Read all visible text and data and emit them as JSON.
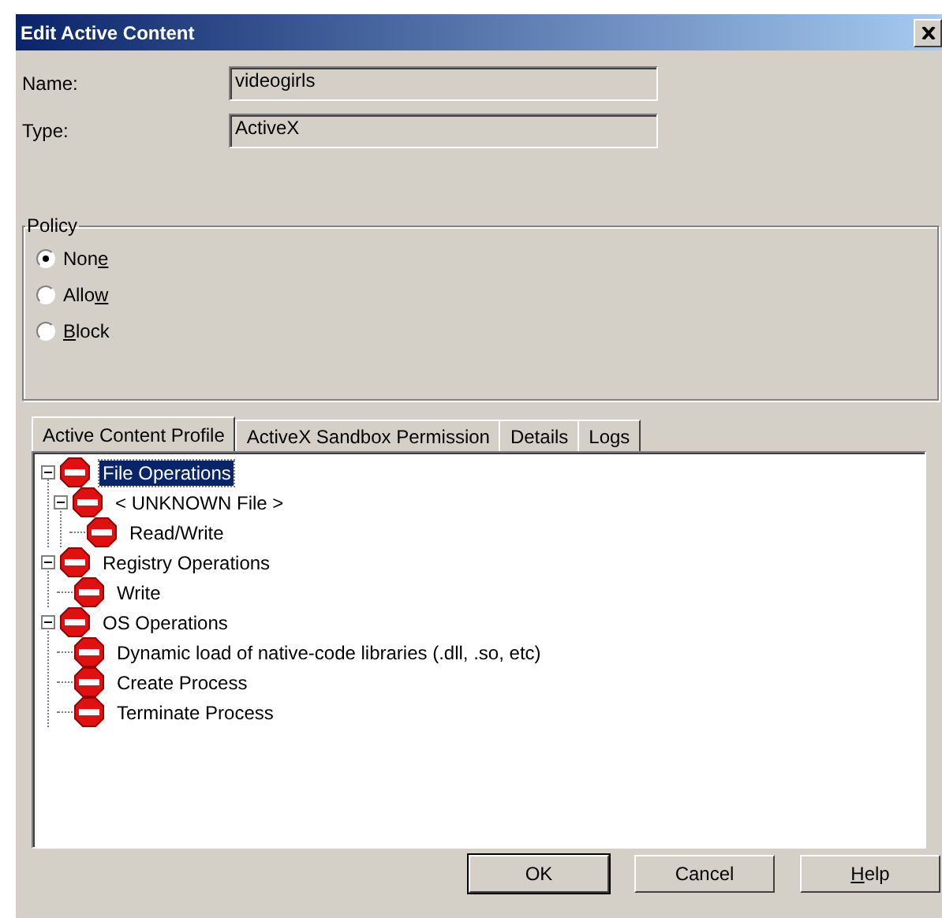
{
  "window": {
    "title": "Edit Active Content"
  },
  "fields": [
    {
      "label": "Name:",
      "value": "videogirls"
    },
    {
      "label": "Type:",
      "value": "ActiveX"
    }
  ],
  "policy": {
    "title": "Policy",
    "options": [
      {
        "before": "Non",
        "key": "e",
        "selected": true
      },
      {
        "before": "Allo",
        "key": "w",
        "selected": false
      },
      {
        "key": "B",
        "after": "lock",
        "selected": false
      }
    ]
  },
  "tabs": [
    {
      "label": "Active Content Profile",
      "selected": true
    },
    {
      "label": "ActiveX  Sandbox Permission",
      "selected": false
    },
    {
      "label": "Details",
      "selected": false
    },
    {
      "label": "Logs",
      "selected": false
    }
  ],
  "tree": [
    {
      "label": "File Operations",
      "selected": true,
      "expanded": true,
      "children": [
        {
          "label": "< UNKNOWN File >",
          "selected": false,
          "expanded": true,
          "children": [
            {
              "label": "Read/Write",
              "selected": false
            }
          ]
        }
      ]
    },
    {
      "label": "Registry Operations",
      "selected": false,
      "expanded": true,
      "children": [
        {
          "label": "Write",
          "selected": false
        }
      ]
    },
    {
      "label": "OS Operations",
      "selected": false,
      "expanded": true,
      "children": [
        {
          "label": "Dynamic load of native-code libraries (.dll, .so, etc)",
          "selected": false
        },
        {
          "label": "Create Process",
          "selected": false
        },
        {
          "label": "Terminate Process",
          "selected": false
        }
      ]
    }
  ],
  "buttons": [
    {
      "before": "OK",
      "default": true
    },
    {
      "before": "Cancel",
      "default": false
    },
    {
      "key": "H",
      "after": "elp",
      "default": false
    }
  ]
}
